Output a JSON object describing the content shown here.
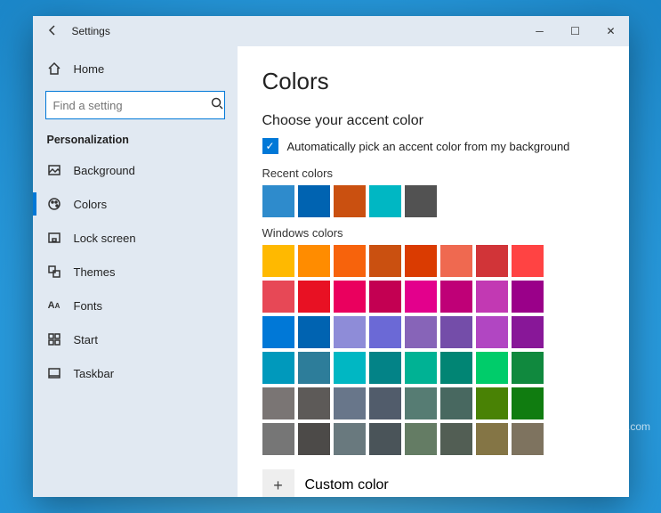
{
  "titlebar": {
    "app": "Settings"
  },
  "sidebar": {
    "home": "Home",
    "search_placeholder": "Find a setting",
    "section": "Personalization",
    "items": [
      {
        "label": "Background"
      },
      {
        "label": "Colors"
      },
      {
        "label": "Lock screen"
      },
      {
        "label": "Themes"
      },
      {
        "label": "Fonts"
      },
      {
        "label": "Start"
      },
      {
        "label": "Taskbar"
      }
    ]
  },
  "content": {
    "title": "Colors",
    "section_title": "Choose your accent color",
    "auto_pick": "Automatically pick an accent color from my background",
    "recent_label": "Recent colors",
    "recent_colors": [
      "#2e8bcc",
      "#0063b1",
      "#ca5010",
      "#00b7c3",
      "#525252"
    ],
    "windows_label": "Windows colors",
    "windows_colors": [
      "#ffb900",
      "#ff8c00",
      "#f7630c",
      "#ca5010",
      "#da3b01",
      "#ef6950",
      "#d13438",
      "#ff4343",
      "#e74856",
      "#e81123",
      "#ea005e",
      "#c30052",
      "#e3008c",
      "#bf0077",
      "#c239b3",
      "#9a0089",
      "#0078d7",
      "#0063b1",
      "#8e8cd8",
      "#6b69d6",
      "#8764b8",
      "#744da9",
      "#b146c2",
      "#881798",
      "#0099bc",
      "#2d7d9a",
      "#00b7c3",
      "#038387",
      "#00b294",
      "#018574",
      "#00cc6a",
      "#10893e",
      "#7a7574",
      "#5d5a58",
      "#68768a",
      "#515c6b",
      "#567c73",
      "#486860",
      "#498205",
      "#107c10",
      "#767676",
      "#4c4a48",
      "#69797e",
      "#4a5459",
      "#647c64",
      "#525e54",
      "#847545",
      "#7e735f"
    ],
    "custom_label": "Custom color"
  },
  "watermark": "wsxdn.com"
}
